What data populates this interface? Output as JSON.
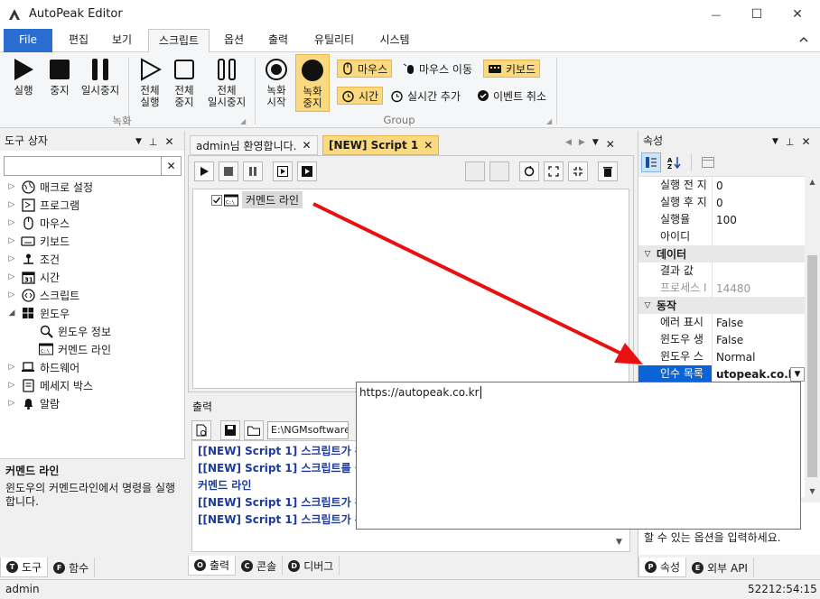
{
  "window": {
    "title": "AutoPeak Editor",
    "minimize": "—",
    "maximize": "☐",
    "close": "✕"
  },
  "ribbon_tabs": [
    {
      "label": "File"
    },
    {
      "label": "편집"
    },
    {
      "label": "보기"
    },
    {
      "label": "스크립트"
    },
    {
      "label": "옵션"
    },
    {
      "label": "출력"
    },
    {
      "label": "유틸리티"
    },
    {
      "label": "시스템"
    }
  ],
  "ribbon": {
    "run": "실행",
    "stop": "중지",
    "pause": "일시중지",
    "run_all_1": "전체",
    "run_all_2": "실행",
    "stop_all_1": "전체",
    "stop_all_2": "중지",
    "pause_all_1": "전체",
    "pause_all_2": "일시중지",
    "group_record": "녹화",
    "rec_start_1": "녹화",
    "rec_start_2": "시작",
    "rec_stop_1": "녹화",
    "rec_stop_2": "중지",
    "mouse": "마우스",
    "mouse_move": "마우스 이동",
    "keyboard": "키보드",
    "time": "시간",
    "realtime_add": "실시간 추가",
    "event_cancel": "이벤트 취소",
    "group_label": "Group"
  },
  "left_panel": {
    "title": "도구 상자",
    "search_value": "",
    "tree": [
      {
        "label": "매크로 설정",
        "icon": "globe-icon"
      },
      {
        "label": "프로그램",
        "icon": "program-icon"
      },
      {
        "label": "마우스",
        "icon": "mouse-icon"
      },
      {
        "label": "키보드",
        "icon": "keyboard-icon"
      },
      {
        "label": "조건",
        "icon": "condition-icon"
      },
      {
        "label": "시간",
        "icon": "calendar-icon"
      },
      {
        "label": "스크립트",
        "icon": "script-icon"
      },
      {
        "label": "윈도우",
        "icon": "windows-icon"
      },
      {
        "label": "윈도우 정보",
        "icon": "magnifier-icon"
      },
      {
        "label": "커멘드 라인",
        "icon": "cmd-icon"
      },
      {
        "label": "하드웨어",
        "icon": "laptop-icon"
      },
      {
        "label": "메세지 박스",
        "icon": "message-icon"
      },
      {
        "label": "알람",
        "icon": "bell-icon"
      }
    ],
    "desc_title": "커멘드 라인",
    "desc_text": "윈도우의 커멘드라인에서 명령을 실행합니다.",
    "tabs": [
      {
        "key": "T",
        "label": "도구"
      },
      {
        "key": "F",
        "label": "함수"
      }
    ]
  },
  "doc": {
    "tabs": [
      {
        "label": "admin님 환영합니다."
      },
      {
        "label": "[NEW] Script 1"
      }
    ],
    "node_label": "커멘드 라인"
  },
  "output": {
    "title": "출력",
    "path": "E:\\NGMsoftware\\",
    "lines": [
      "[[NEW] Script 1] 스크립트가 완료",
      "[[NEW] Script 1] 스크립트를 실행",
      "커멘드 라인",
      "[[NEW] Script 1] 스크립트가 완료",
      "[[NEW] Script 1] 스크립트가 완료"
    ],
    "tabs": [
      {
        "key": "O",
        "label": "출력"
      },
      {
        "key": "C",
        "label": "콘솔"
      },
      {
        "key": "D",
        "label": "디버그"
      }
    ]
  },
  "props": {
    "title": "속성",
    "rows": [
      {
        "type": "row",
        "key": "실행 전 지",
        "value": "0"
      },
      {
        "type": "row",
        "key": "실행 후 지",
        "value": "0"
      },
      {
        "type": "row",
        "key": "실행율",
        "value": "100"
      },
      {
        "type": "row",
        "key": "아이디",
        "value": ""
      },
      {
        "type": "cat",
        "key": "데이터"
      },
      {
        "type": "row",
        "key": "결과 값",
        "value": ""
      },
      {
        "type": "row",
        "key": "프로세스 I",
        "value": "14480",
        "dim": true
      },
      {
        "type": "cat",
        "key": "동작"
      },
      {
        "type": "row",
        "key": "에러 표시",
        "value": "False"
      },
      {
        "type": "row",
        "key": "윈도우 생",
        "value": "False"
      },
      {
        "type": "row",
        "key": "윈도우 스",
        "value": "Normal"
      },
      {
        "type": "row",
        "key": "인수 목록",
        "value": "utopeak.co.kr",
        "selected": true
      }
    ],
    "help_text": "할 수 있는 옵션을 입력하세요.",
    "tabs": [
      {
        "key": "P",
        "label": "속성"
      },
      {
        "key": "E",
        "label": "외부 API"
      }
    ]
  },
  "popup": {
    "value": "https://autopeak.co.kr"
  },
  "status": {
    "user": "admin",
    "time": "52212:54:15"
  }
}
